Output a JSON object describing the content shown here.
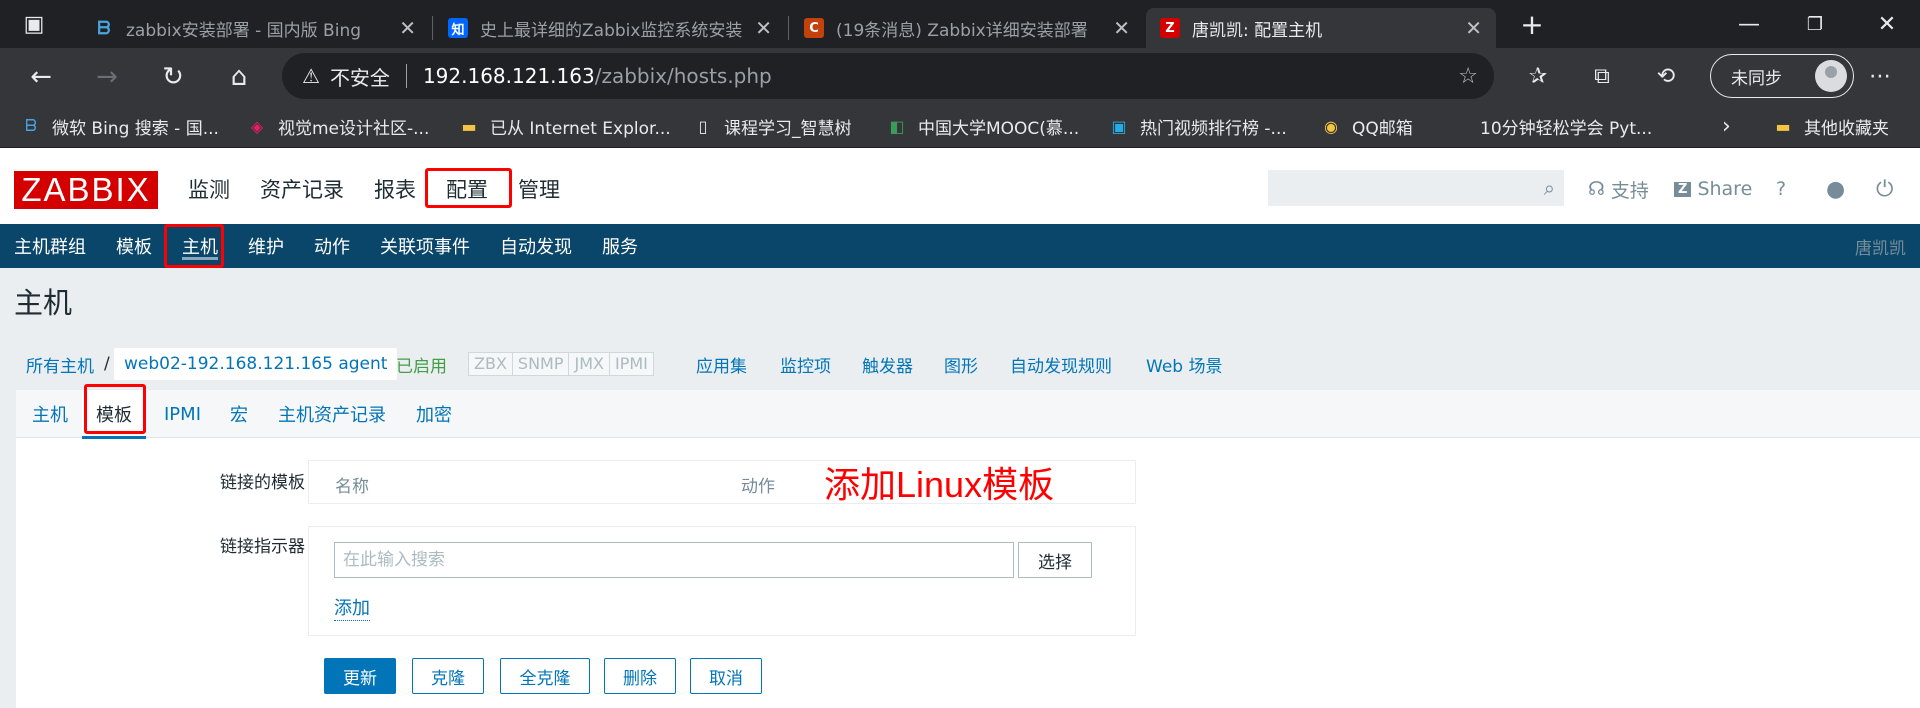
{
  "browser": {
    "tabs": [
      {
        "title": "zabbix安装部署 - 国内版 Bing",
        "favicon": "bing-icon"
      },
      {
        "title": "史上最详细的Zabbix监控系统安装",
        "favicon": "zhihu-icon"
      },
      {
        "title": "(19条消息) Zabbix详细安装部署",
        "favicon": "csdn-icon"
      },
      {
        "title": "唐凯凯: 配置主机",
        "favicon": "zabbix-icon",
        "active": true
      }
    ],
    "address": {
      "security_label": "不安全",
      "host": "192.168.121.163",
      "path": "/zabbix/hosts.php"
    },
    "sync_label": "未同步",
    "bookmarks": [
      "微软 Bing 搜索 - 国...",
      "视觉me设计社区-...",
      "已从 Internet Explor...",
      "课程学习_智慧树",
      "中国大学MOOC(慕...",
      "热门视频排行榜 -...",
      "QQ邮箱",
      "10分钟轻松学会 Pyt...",
      "其他收藏夹"
    ]
  },
  "zabbix": {
    "logo": "ZABBIX",
    "main_menu": [
      "监测",
      "资产记录",
      "报表",
      "配置",
      "管理"
    ],
    "header_links": {
      "support": "支持",
      "share": "Share",
      "help": "?"
    },
    "sub_menu": [
      "主机群组",
      "模板",
      "主机",
      "维护",
      "动作",
      "关联项事件",
      "自动发现",
      "服务"
    ],
    "user": "唐凯凯",
    "page_title": "主机",
    "breadcrumb": {
      "all_hosts": "所有主机",
      "sep": "/",
      "host": "web02-192.168.121.165 agent"
    },
    "status": "已启用",
    "availability": [
      "ZBX",
      "SNMP",
      "JMX",
      "IPMI"
    ],
    "host_links": [
      "应用集",
      "监控项",
      "触发器",
      "图形",
      "自动发现规则",
      "Web 场景"
    ],
    "form_tabs": [
      "主机",
      "模板",
      "IPMI",
      "宏",
      "主机资产记录",
      "加密"
    ],
    "form": {
      "linked_templates_label": "链接的模板",
      "col_name": "名称",
      "col_action": "动作",
      "link_new_label": "链接指示器",
      "search_placeholder": "在此输入搜索",
      "select_label": "选择",
      "add_label": "添加",
      "buttons": [
        "更新",
        "克隆",
        "全克隆",
        "删除",
        "取消"
      ]
    },
    "annotation": "添加Linux模板"
  }
}
